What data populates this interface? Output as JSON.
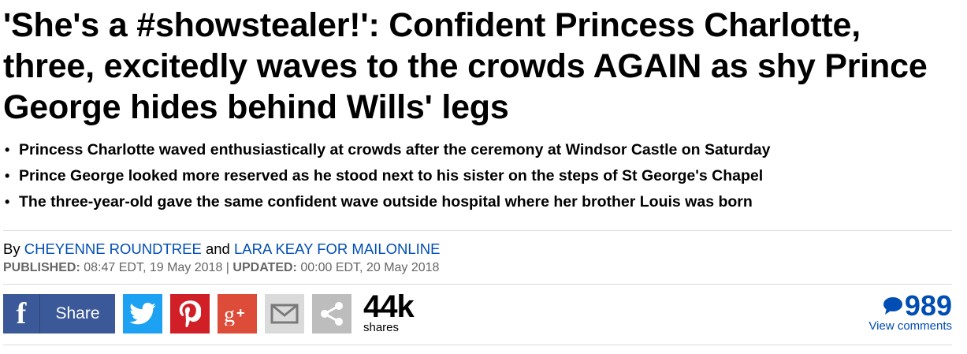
{
  "article": {
    "headline": "'She's a #showstealer!': Confident Princess Charlotte, three, excitedly waves to the crowds AGAIN as shy Prince George hides behind Wills' legs",
    "bullets": [
      "Princess Charlotte waved enthusiastically at crowds after the ceremony at Windsor Castle on Saturday",
      "Prince George looked more reserved as he stood next to his sister on the steps of St George's Chapel",
      "The three-year-old gave the same confident wave outside hospital where her brother Louis was born"
    ],
    "bullet_glyph": "•"
  },
  "byline": {
    "prefix": "By",
    "author1": "CHEYENNE ROUNDTREE",
    "joiner": "and",
    "author2": "LARA KEAY FOR MAILONLINE"
  },
  "dates": {
    "published_label": "PUBLISHED:",
    "published_value": "08:47 EDT, 19 May 2018",
    "separator": "|",
    "updated_label": "UPDATED:",
    "updated_value": "00:00 EDT, 20 May 2018"
  },
  "share": {
    "facebook_label": "Share",
    "facebook_glyph": "f",
    "count": "44k",
    "count_label": "shares",
    "colors": {
      "facebook": "#3b5998",
      "twitter": "#1da1f2",
      "pinterest": "#d01f26",
      "googleplus": "#dd4b39",
      "email": "#dadada",
      "more": "#bdbdbd"
    }
  },
  "comments": {
    "count": "989",
    "label": "View comments",
    "color": "#004db3"
  }
}
